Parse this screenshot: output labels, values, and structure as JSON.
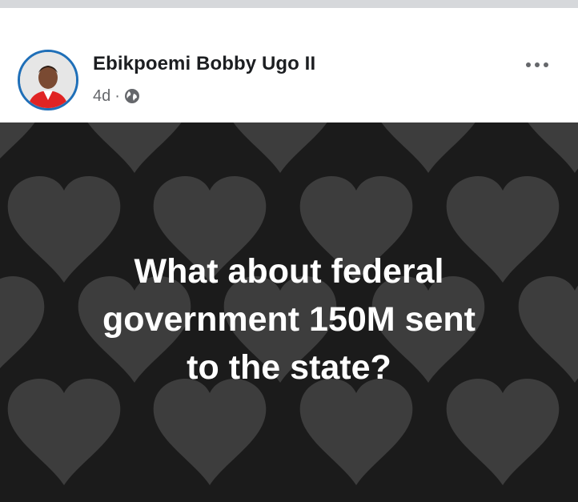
{
  "post": {
    "author_name": "Ebikpoemi Bobby Ugo II",
    "time_ago": "4d",
    "separator": "·",
    "privacy_icon": "globe-icon",
    "options_icon": "more-horizontal-icon",
    "background_style": "dark-hearts-pattern",
    "text_lines": [
      "What about federal",
      "government 150M sent",
      "to the state?"
    ]
  },
  "colors": {
    "page_background": "#ffffff",
    "top_strip": "#d6d8db",
    "name_text": "#1c1e21",
    "meta_text": "#65676b",
    "avatar_ring": "#1f6fb8",
    "post_background": "#1b1b1b",
    "heart_shape": "#3d3d3d",
    "post_text": "#ffffff"
  }
}
